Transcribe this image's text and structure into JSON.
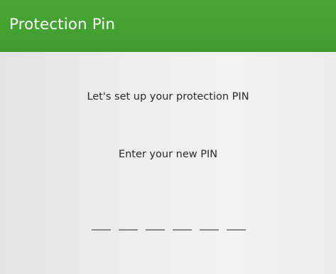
{
  "app_bar": {
    "title": "Protection Pin"
  },
  "main": {
    "setup_prompt": "Let's set up your protection PIN",
    "enter_prompt": "Enter your new PIN",
    "pin_length": 6,
    "pin_entered": ""
  },
  "colors": {
    "app_bar": "#43a131",
    "background": "#ececec",
    "text": "#2a2a2a",
    "pin_slot": "#8b8b8b"
  }
}
